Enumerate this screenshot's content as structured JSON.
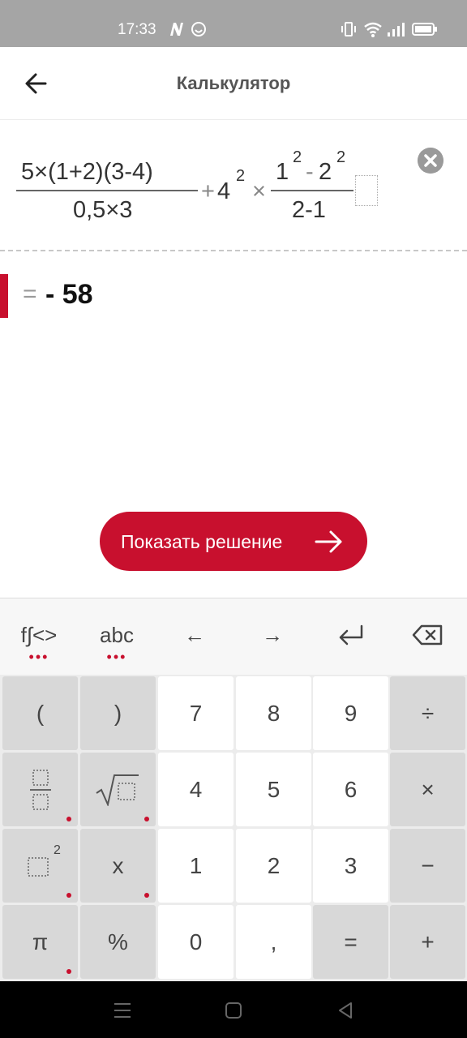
{
  "status_bar": {
    "time": "17:33",
    "icons": [
      "n-logo-icon",
      "emoji-icon",
      "vibrate-icon",
      "wifi-icon",
      "signal-icon",
      "battery-icon"
    ]
  },
  "app_bar": {
    "title": "Калькулятор",
    "back_icon": "arrow-left-icon"
  },
  "expression": {
    "frac1_num": "5×(1+2)(3-4)",
    "frac1_den": "0,5×3",
    "plus": "+",
    "base4": "4",
    "exp4": "2",
    "times": "×",
    "frac2_num_a": "1",
    "frac2_num_a_exp": "2",
    "frac2_num_minus": "-",
    "frac2_num_b": "2",
    "frac2_num_b_exp": "2",
    "frac2_den": "2-1"
  },
  "result": {
    "eq": "=",
    "value": "- 58"
  },
  "solution_button": {
    "label": "Показать решение"
  },
  "keyboard": {
    "top_row": [
      {
        "label": "f∫<>",
        "dots": "•••"
      },
      {
        "label": "abc",
        "dots": "•••"
      },
      {
        "label": "←"
      },
      {
        "label": "→"
      },
      {
        "label": "enter-icon"
      },
      {
        "label": "backspace-icon"
      }
    ],
    "keys": {
      "lparen": "(",
      "rparen": ")",
      "seven": "7",
      "eight": "8",
      "nine": "9",
      "divide": "÷",
      "four": "4",
      "five": "5",
      "six": "6",
      "multiply": "×",
      "square_exp": "2",
      "x": "x",
      "one": "1",
      "two": "2",
      "three": "3",
      "minus": "−",
      "pi": "π",
      "percent": "%",
      "zero": "0",
      "comma": ",",
      "equals": "=",
      "plus": "+"
    }
  },
  "colors": {
    "accent": "#c8102e",
    "status_bar": "#a5a5a5",
    "key_grey": "#d8d8d8",
    "keyboard_bg": "#ececec"
  }
}
